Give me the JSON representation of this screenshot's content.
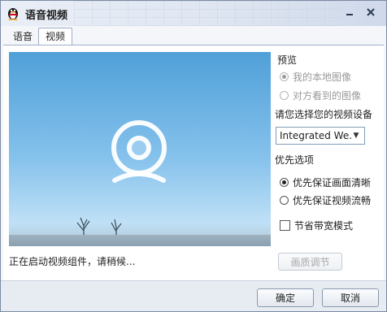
{
  "window": {
    "title": "语音视频"
  },
  "tabs": [
    {
      "label": "语音"
    },
    {
      "label": "视频"
    }
  ],
  "preview": {
    "heading": "预览",
    "options": [
      {
        "label": "我的本地图像"
      },
      {
        "label": "对方看到的图像"
      }
    ]
  },
  "device": {
    "label": "请您选择您的视频设备",
    "selected": "Integrated We..."
  },
  "priority": {
    "heading": "优先选项",
    "options": [
      {
        "label": "优先保证画面清晰"
      },
      {
        "label": "优先保证视频流畅"
      }
    ]
  },
  "bandwidth_mode": {
    "label": "节省带宽模式"
  },
  "quality_button": {
    "label": "画质调节"
  },
  "status": {
    "text": "正在启动视频组件，请稍候..."
  },
  "footer": {
    "ok": "确定",
    "cancel": "取消"
  }
}
